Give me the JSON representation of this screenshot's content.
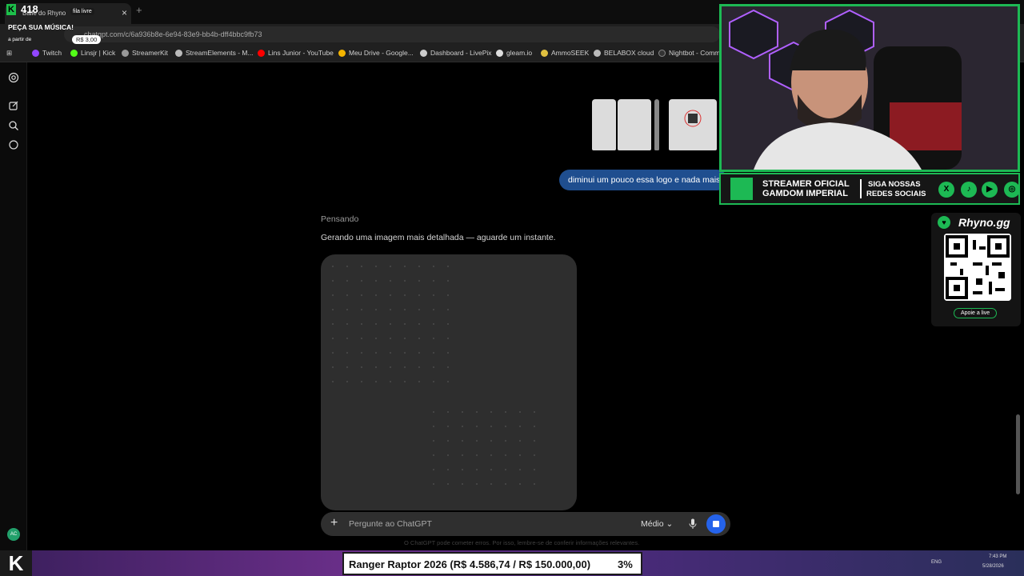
{
  "browser": {
    "tab_title": "Baile do Rhyno",
    "url": "chatgpt.com/c/6a936b8e-6e94-83e9-bb4b-dff4bbc9fb73",
    "bookmarks": [
      "Twitch",
      "Linsjr | Kick",
      "StreamerKit",
      "StreamElements - M...",
      "Lins Junior - YouTube",
      "Meu Drive - Google...",
      "Dashboard - LivePix",
      "gleam.io",
      "AmmoSEEK",
      "BELABOX cloud",
      "Nightbot - Comm"
    ]
  },
  "overlay_topleft": {
    "viewer_count": "418",
    "fila": "fila livre",
    "title": "PEÇA SUA MÚSICA!",
    "sub": "a partir de",
    "price": "R$ 3,00"
  },
  "chat": {
    "user_message": "diminui um pouco essa logo e nada mais",
    "thinking_label": "Pensando",
    "assistant_message": "Gerando uma imagem mais detalhada — aguarde um instante.",
    "composer_placeholder": "Pergunte ao ChatGPT",
    "model_label": "Médio",
    "disclaimer": "O ChatGPT pode cometer erros. Por isso, lembre-se de conferir informações relevantes."
  },
  "avatar_initials": "AC",
  "webcam_banner": {
    "line1": "STREAMER OFICIAL",
    "line2": "GAMDOM IMPERIAL",
    "right1": "SIGA NOSSAS",
    "right2": "REDES SOCIAIS"
  },
  "social_icons": [
    "x-icon",
    "tiktok-icon",
    "youtube-icon",
    "instagram-icon"
  ],
  "qr_card": {
    "brand": "Rhyno.gg",
    "cta": "Apoie a live"
  },
  "ticker": {
    "goal_text": "Ranger Raptor 2026 (R$ 4.586,74 / R$ 150.000,00)",
    "goal_percent": "3%"
  },
  "tray": {
    "lang": "ENG",
    "time": "7:43 PM",
    "date": "5/28/2026"
  },
  "colors": {
    "accent_green": "#1db954",
    "user_bubble": "#1f4e8f",
    "stop_button": "#2563eb"
  }
}
